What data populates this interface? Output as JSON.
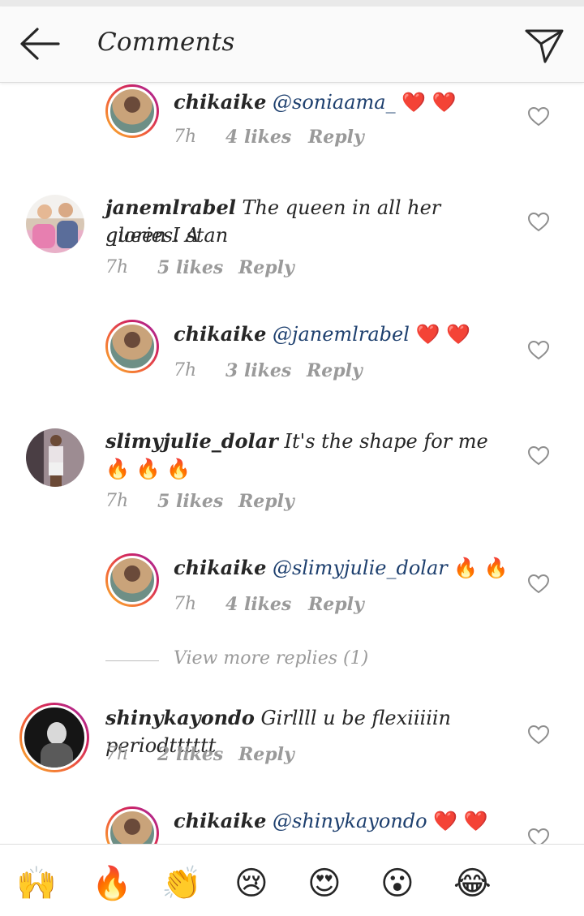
{
  "header": {
    "title": "Comments",
    "back_icon": "back-arrow-icon",
    "send_icon": "send-icon"
  },
  "comments": [
    {
      "user": "chikaike",
      "mention": "@soniaama_",
      "text": "",
      "emoji": "❤️ ❤️",
      "time": "7h",
      "likes": "4 likes",
      "reply": "Reply"
    },
    {
      "user": "janemlrabel",
      "mention": "",
      "text": "The queen in all her glories. A",
      "text2": "queen I stan",
      "emoji": "",
      "time": "7h",
      "likes": "5 likes",
      "reply": "Reply"
    },
    {
      "user": "chikaike",
      "mention": "@janemlrabel",
      "text": "",
      "emoji": "❤️ ❤️",
      "time": "7h",
      "likes": "3 likes",
      "reply": "Reply"
    },
    {
      "user": "slimyjulie_dolar",
      "mention": "",
      "text": "It's the shape for me",
      "emoji": "🔥 🔥",
      "emoji2": "🔥 🔥 🔥",
      "time": "7h",
      "likes": "5 likes",
      "reply": "Reply"
    },
    {
      "user": "chikaike",
      "mention": "@slimyjulie_dolar",
      "text": "",
      "emoji": "🔥 🔥",
      "time": "7h",
      "likes": "4 likes",
      "reply": "Reply"
    },
    {
      "user": "shinykayondo",
      "mention": "",
      "text": "Girllll u be flexiiiiin periodtttttt",
      "emoji": "",
      "time": "7h",
      "likes": "2 likes",
      "reply": "Reply"
    },
    {
      "user": "chikaike",
      "mention": "@shinykayondo",
      "text": "",
      "emoji": "❤️ ❤️",
      "time": "",
      "likes": "",
      "reply": ""
    }
  ],
  "view_more": "View more replies (1)",
  "emoji_bar": [
    "🙌",
    "🔥",
    "👏",
    "😢",
    "😍",
    "😮",
    "😂"
  ],
  "colors": {
    "mention": "#1d3f6e",
    "meta": "#9a9a9a",
    "heart_emoji": "#e0457b"
  }
}
